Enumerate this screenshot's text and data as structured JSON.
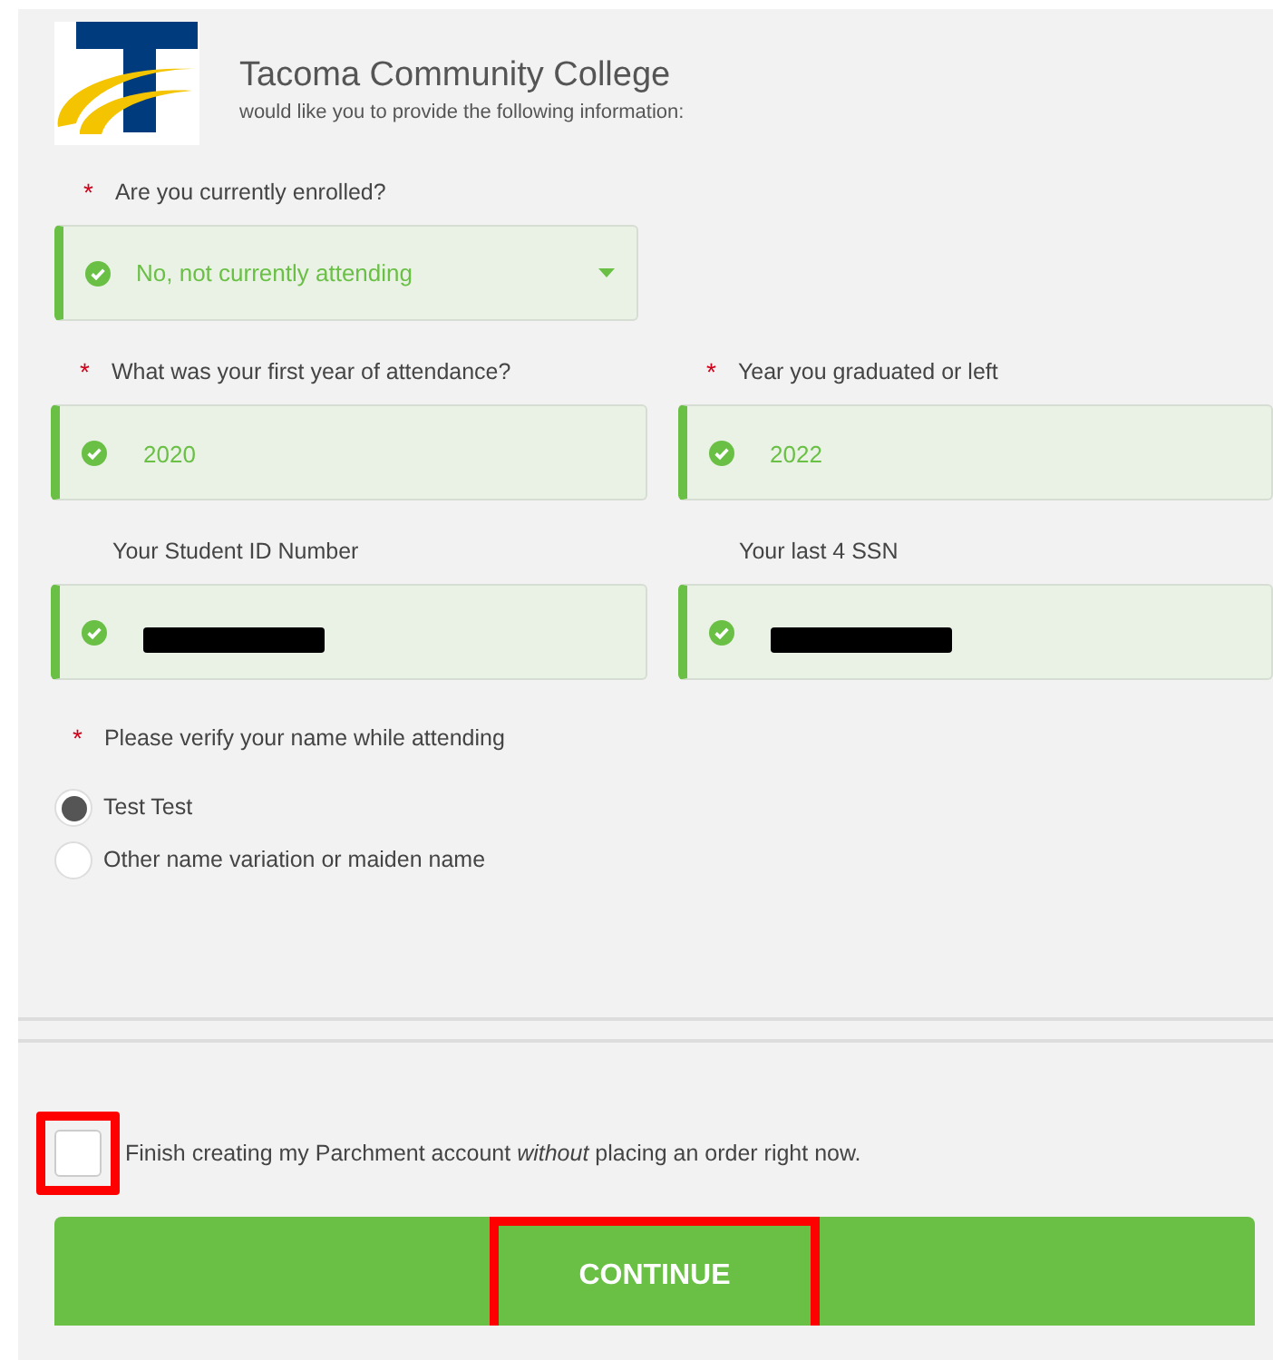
{
  "header": {
    "institution": "Tacoma Community College",
    "subtitle": "would like you to provide the following information:"
  },
  "enrolled": {
    "required_mark": "*",
    "label": "Are you currently enrolled?",
    "value": "No, not currently attending",
    "valid": true
  },
  "field_rows": [
    {
      "fields": [
        {
          "required_mark": "*",
          "label": "What was your first year of attendance?",
          "value": "2020",
          "valid": true,
          "redacted": false
        },
        {
          "required_mark": "*",
          "label": "Year you graduated or left",
          "value": "2022",
          "valid": true,
          "redacted": false
        }
      ]
    },
    {
      "fields": [
        {
          "label": "Your Student ID Number",
          "valid": true,
          "redacted": true
        },
        {
          "label": "Your last 4 SSN",
          "valid": true,
          "redacted": true
        }
      ]
    }
  ],
  "name_question": {
    "required_mark": "*",
    "label": "Please verify your name while attending",
    "options": [
      {
        "label": "Test Test",
        "selected": true
      },
      {
        "label": "Other name variation or maiden name",
        "selected": false
      }
    ]
  },
  "account_option": {
    "text": "Finish creating my Parchment account *without* placing an order right now.",
    "checked": false,
    "highlighted": true
  },
  "continue_button": {
    "label": "CONTINUE",
    "highlighted": true
  }
}
